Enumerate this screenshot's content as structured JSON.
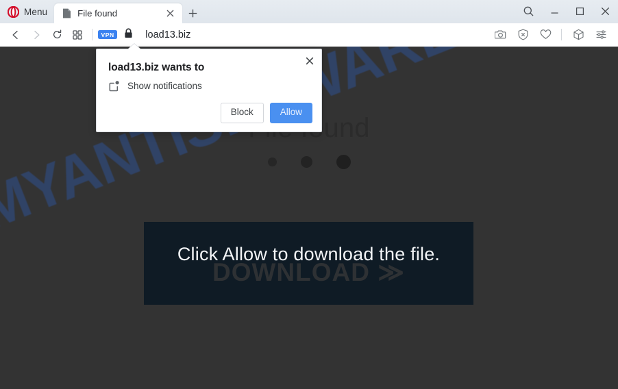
{
  "browser": {
    "menu_label": "Menu",
    "menu_icon": "opera-logo-icon",
    "tab": {
      "title": "File found",
      "favicon": "file-document-icon",
      "close_icon": "close-icon"
    },
    "new_tab_icon": "plus-icon",
    "window_controls": {
      "search_icon": "search-icon",
      "minimize_icon": "minimize-icon",
      "maximize_icon": "maximize-icon",
      "close_icon": "close-icon"
    },
    "nav": {
      "back_icon": "chevron-left-icon",
      "forward_icon": "chevron-right-icon",
      "reload_icon": "reload-icon",
      "tabmenu_icon": "grid-squares-icon",
      "vpn_badge": "VPN",
      "lock_icon": "padlock-icon",
      "url": "load13.biz",
      "right_icons": [
        "camera-snapshot-icon",
        "shield-block-ads-icon",
        "heart-icon",
        "cube-extensions-icon",
        "sliders-easy-setup-icon"
      ]
    },
    "colors": {
      "vpn_badge_bg": "#3b82f0",
      "opera_red": "#d40f2c",
      "tabstrip_bg": "#e4eaf0"
    }
  },
  "page": {
    "watermark": "MYANTISPYWARE.COM",
    "watermark_color": "#2f4d86",
    "heading": "File found",
    "background_color": "#333333",
    "loader_dots": 3,
    "download_box": {
      "message": "Click Allow to download the file.",
      "ghost_label": "DOWNLOAD ≫",
      "background_color": "#0f1b25"
    }
  },
  "permission_dialog": {
    "title": "load13.biz wants to",
    "permission_icon": "notification-badge-icon",
    "permission_label": "Show notifications",
    "close_icon": "close-icon",
    "block_label": "Block",
    "allow_label": "Allow",
    "allow_color": "#4a90f0"
  }
}
